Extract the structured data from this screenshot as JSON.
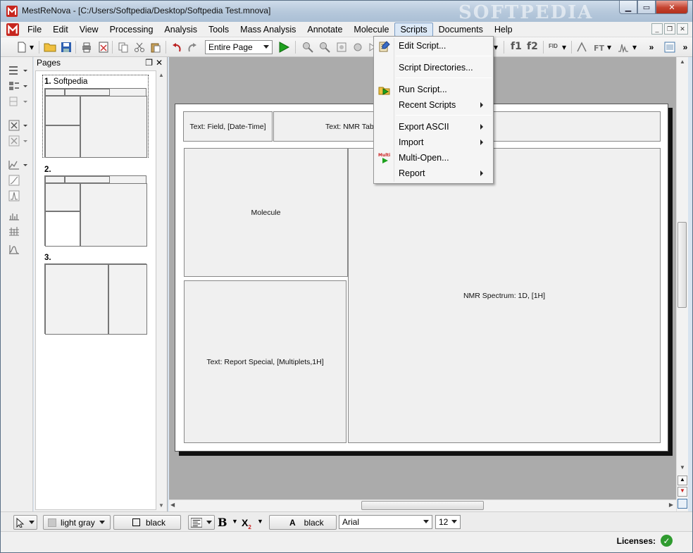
{
  "window": {
    "title": "MestReNova - [C:/Users/Softpedia/Desktop/Softpedia Test.mnova]",
    "watermark": "SOFTPEDIA"
  },
  "menubar": {
    "items": [
      "File",
      "Edit",
      "View",
      "Processing",
      "Analysis",
      "Tools",
      "Mass Analysis",
      "Annotate",
      "Molecule",
      "Scripts",
      "Documents",
      "Help"
    ],
    "active": "Scripts"
  },
  "toolbar": {
    "zoom_value": "Entire Page",
    "f1_label": "f1",
    "f2_label": "f2",
    "fid_label": "FID",
    "overflow": "»"
  },
  "pages_panel": {
    "title": "Pages",
    "pages": [
      {
        "number": "1.",
        "name": "Softpedia"
      },
      {
        "number": "2.",
        "name": ""
      },
      {
        "number": "3.",
        "name": ""
      }
    ]
  },
  "document": {
    "boxes": {
      "field": "Text: Field, [Date-Time]",
      "nmr_table": "Text: NMR Table",
      "molecule": "Molecule",
      "report": "Text: Report Special, [Multiplets,1H]",
      "spectrum": "NMR Spectrum: 1D, [1H]"
    }
  },
  "scripts_menu": {
    "items": [
      {
        "label": "Edit Script...",
        "submenu": false,
        "icon": "edit-script-icon"
      },
      {
        "label": "Script Directories...",
        "submenu": false,
        "icon": ""
      },
      {
        "label": "Run Script...",
        "submenu": false,
        "icon": "run-script-icon"
      },
      {
        "label": "Recent Scripts",
        "submenu": true,
        "icon": ""
      },
      {
        "label": "Export ASCII",
        "submenu": true,
        "icon": ""
      },
      {
        "label": "Import",
        "submenu": true,
        "icon": ""
      },
      {
        "label": "Multi-Open...",
        "submenu": false,
        "icon": "multi-open-icon"
      },
      {
        "label": "Report",
        "submenu": true,
        "icon": ""
      }
    ]
  },
  "propbar": {
    "fill_color": "light gray",
    "line_color": "black",
    "font_color_letter": "A",
    "font_color": "black",
    "font_name": "Arial",
    "font_size": "12"
  },
  "statusbar": {
    "licenses_label": "Licenses:"
  },
  "colors": {
    "accent": "#7a9cc4",
    "run_green": "#1ea11e",
    "close_red": "#c4432f"
  }
}
